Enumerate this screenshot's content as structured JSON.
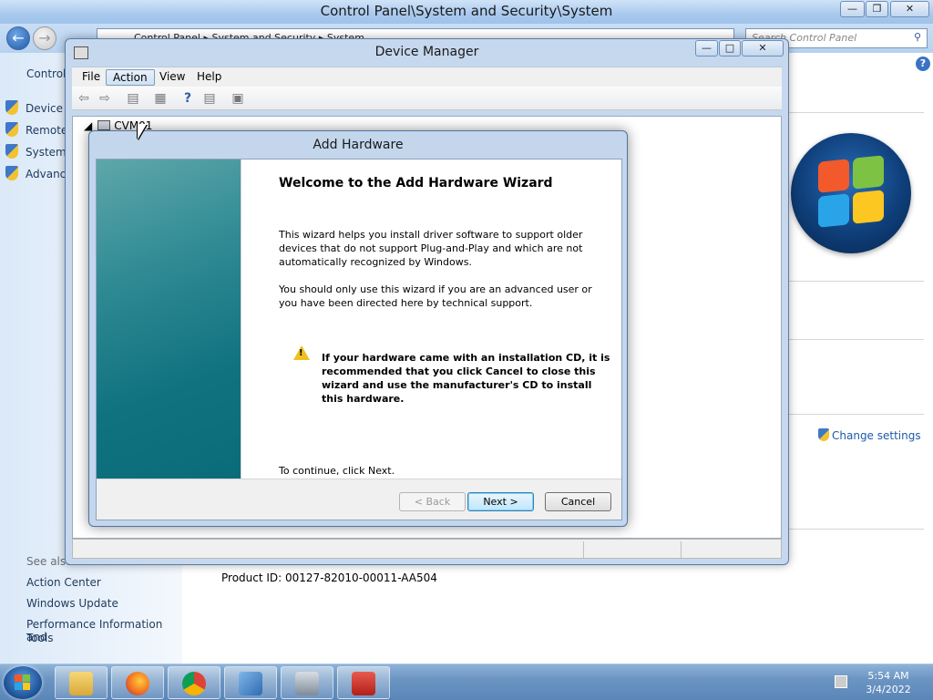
{
  "control_panel": {
    "window_title": "Control Panel\\System and Security\\System",
    "breadcrumb": [
      "Control Panel",
      "System and Security",
      "System"
    ],
    "search_placeholder": "Search Control Panel",
    "left_heading_truncated": "Control",
    "left_tasks": [
      "Device M",
      "Remote",
      "System",
      "Advanc"
    ],
    "see_also_label": "See also",
    "see_also_links": [
      "Action Center",
      "Windows Update",
      "Performance Information and",
      "Tools"
    ],
    "change_settings": "Change settings",
    "product_id": "Product ID: 00127-82010-00011-AA504"
  },
  "device_manager": {
    "title": "Device Manager",
    "menu": [
      "File",
      "Action",
      "View",
      "Help"
    ],
    "active_menu": "Action",
    "tree_root": "CVM01"
  },
  "wizard": {
    "title": "Add Hardware",
    "heading": "Welcome to the Add Hardware Wizard",
    "para1": "This wizard helps you install driver software to support older devices that do not support Plug-and-Play and which are not automatically recognized by Windows.",
    "para2": "You should only use this wizard if you are an advanced user or you have been directed here by technical support.",
    "warning": "If your hardware came with an installation CD, it is recommended that you click Cancel to close this wizard and use the manufacturer's CD to install this hardware.",
    "continue_text": "To continue, click Next.",
    "buttons": {
      "back": "< Back",
      "next": "Next >",
      "cancel": "Cancel"
    }
  },
  "taskbar": {
    "time": "5:54 AM",
    "date": "3/4/2022",
    "pinned_icons": [
      "file-explorer-icon",
      "firefox-icon",
      "chrome-icon",
      "control-panel-icon",
      "computer-management-icon",
      "toolbox-icon"
    ]
  },
  "colors": {
    "wizard_banner": "#10727f",
    "link": "#1e5aa8",
    "taskbar": "#6c95c2"
  }
}
